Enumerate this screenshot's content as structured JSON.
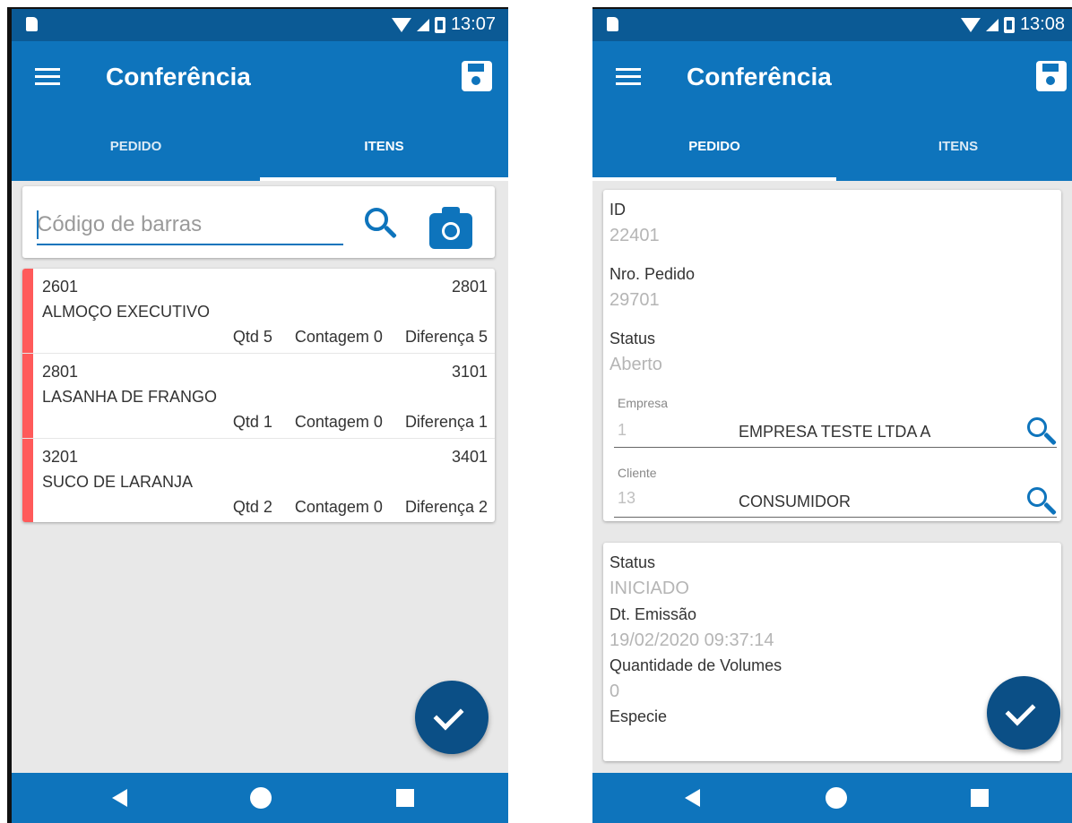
{
  "status_bar": {
    "left_time": "13:07",
    "right_time": "13:08"
  },
  "app": {
    "title": "Conferência"
  },
  "tabs": [
    "PEDIDO",
    "ITENS"
  ],
  "left": {
    "search_placeholder": "Código de barras",
    "items": [
      {
        "code": "2601",
        "ref": "2801",
        "name": "ALMOÇO EXECUTIVO",
        "qtd": "Qtd 5",
        "contagem": "Contagem 0",
        "diferenca": "Diferença 5"
      },
      {
        "code": "2801",
        "ref": "3101",
        "name": "LASANHA DE FRANGO",
        "qtd": "Qtd 1",
        "contagem": "Contagem 0",
        "diferenca": "Diferença 1"
      },
      {
        "code": "3201",
        "ref": "3401",
        "name": "SUCO DE LARANJA",
        "qtd": "Qtd 2",
        "contagem": "Contagem 0",
        "diferenca": "Diferença 2"
      }
    ],
    "row_accent_color": "#ff5a5a"
  },
  "right": {
    "id_label": "ID",
    "id_value": "22401",
    "pedido_label": "Nro. Pedido",
    "pedido_value": "29701",
    "status_label": "Status",
    "status_value": "Aberto",
    "empresa_label": "Empresa",
    "empresa_code": "1",
    "empresa_name": "EMPRESA TESTE LTDA A",
    "cliente_label": "Cliente",
    "cliente_code": "13",
    "cliente_name": "CONSUMIDOR",
    "status2_label": "Status",
    "status2_value": "INICIADO",
    "emissao_label": "Dt. Emissão",
    "emissao_value": "19/02/2020 09:37:14",
    "volumes_label": "Quantidade de Volumes",
    "volumes_value": "0",
    "especie_label": "Especie"
  },
  "colors": {
    "primary": "#0e74bc",
    "status_bar": "#0b5a95",
    "fab": "#0b4f86"
  },
  "icons": [
    "menu-icon",
    "save-icon",
    "search-icon",
    "camera-icon",
    "check-icon",
    "back-icon",
    "home-icon",
    "recent-apps-icon"
  ]
}
